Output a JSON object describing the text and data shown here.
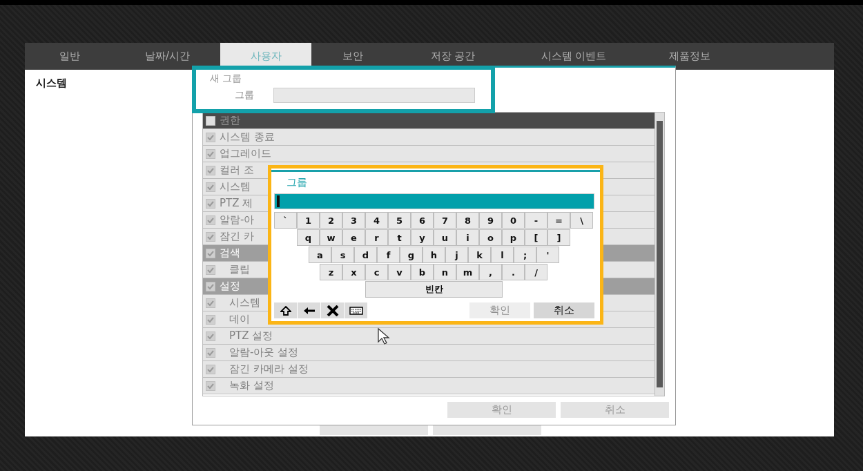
{
  "tabs": [
    {
      "label": "일반",
      "selected": false
    },
    {
      "label": "날짜/시간",
      "selected": false
    },
    {
      "label": "사용자",
      "selected": true
    },
    {
      "label": "보안",
      "selected": false
    },
    {
      "label": "저장 공간",
      "selected": false
    },
    {
      "label": "시스템 이벤트",
      "selected": false
    },
    {
      "label": "제품정보",
      "selected": false
    }
  ],
  "sidebar": {
    "title": "시스템"
  },
  "dialog": {
    "title": "새 그룹",
    "field_label": "그룹",
    "permissions": {
      "header": {
        "label": "권한",
        "checked": false
      },
      "rows": [
        {
          "label": "시스템 종료",
          "checked": true
        },
        {
          "label": "업그레이드",
          "checked": true
        },
        {
          "label": "컬러 조",
          "checked": true
        },
        {
          "label": "시스템",
          "checked": true
        },
        {
          "label": "PTZ 제",
          "checked": true
        },
        {
          "label": "알람-아",
          "checked": true
        },
        {
          "label": "잠긴 카",
          "checked": true
        },
        {
          "label": "검색",
          "checked": true,
          "children": [
            {
              "label": "클립",
              "checked": true
            }
          ]
        },
        {
          "label": "설정",
          "checked": true,
          "children": [
            {
              "label": "시스템",
              "checked": true
            },
            {
              "label": "데이",
              "checked": true
            },
            {
              "label": "PTZ 설정",
              "checked": true
            },
            {
              "label": "알람-아웃 설정",
              "checked": true
            },
            {
              "label": "잠긴 카메라 설정",
              "checked": true
            },
            {
              "label": "녹화 설정",
              "checked": true
            }
          ]
        }
      ]
    },
    "buttons": [
      "확인",
      "취소"
    ]
  },
  "keyboard": {
    "title": "그룹",
    "rows": [
      [
        "`",
        "1",
        "2",
        "3",
        "4",
        "5",
        "6",
        "7",
        "8",
        "9",
        "0",
        "-",
        "=",
        "\\"
      ],
      [
        "",
        "q",
        "w",
        "e",
        "r",
        "t",
        "y",
        "u",
        "i",
        "o",
        "p",
        "[",
        "]"
      ],
      [
        "",
        "a",
        "s",
        "d",
        "f",
        "g",
        "h",
        "j",
        "k",
        "l",
        ";",
        "'"
      ],
      [
        "",
        "",
        "z",
        "x",
        "c",
        "v",
        "b",
        "n",
        "m",
        ",",
        ".",
        "/"
      ]
    ],
    "space": "빈칸",
    "buttons": [
      {
        "label": "확인",
        "disabled": true
      },
      {
        "label": "취소",
        "disabled": false
      }
    ]
  }
}
